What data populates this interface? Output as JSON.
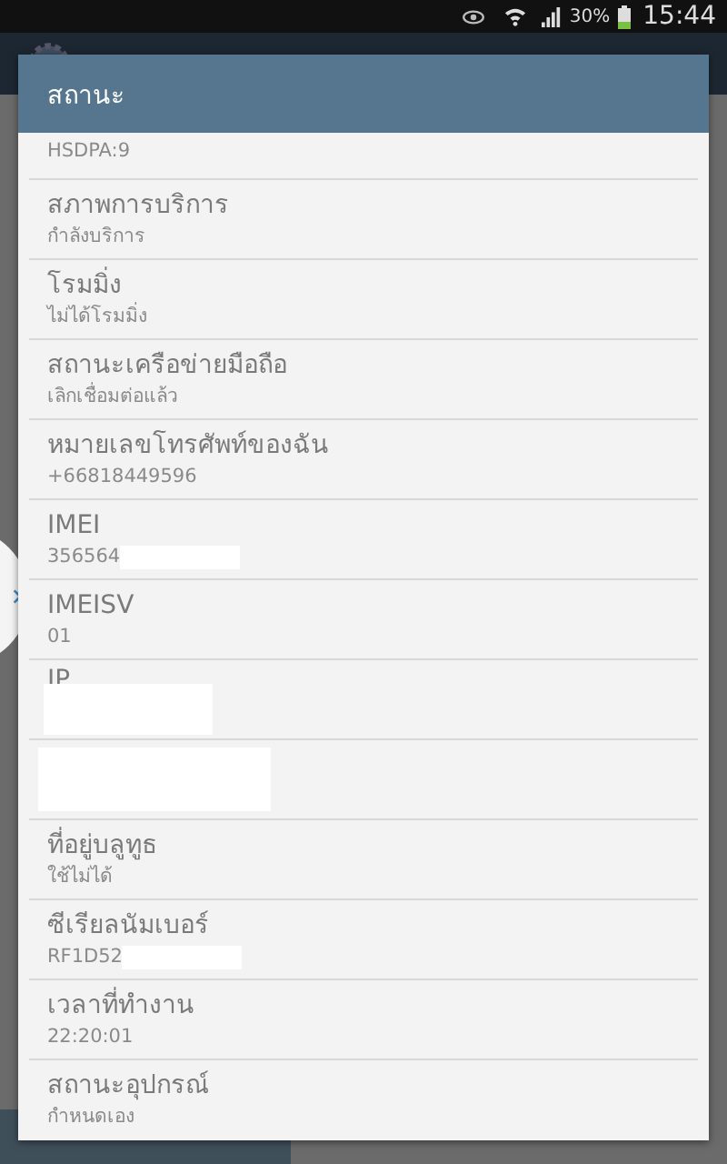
{
  "status_bar": {
    "battery": "30%",
    "time": "15:44"
  },
  "dialog": {
    "title": "สถานะ",
    "rows": [
      {
        "kind": "partial",
        "value": "HSDPA:9"
      },
      {
        "kind": "plain",
        "label": "สภาพการบริการ",
        "value": "กำลังบริการ"
      },
      {
        "kind": "plain",
        "label": "โรมมิ่ง",
        "value": "ไม่ได้โรมมิ่ง"
      },
      {
        "kind": "plain",
        "label": "สถานะเครือข่ายมือถือ",
        "value": "เลิกเชื่อมต่อแล้ว"
      },
      {
        "kind": "plain",
        "label": "หมายเลขโทรศัพท์ของฉัน",
        "value": "+66818449596"
      },
      {
        "kind": "redacted_value",
        "label": "IMEI",
        "value": "356564"
      },
      {
        "kind": "plain",
        "label": "IMEISV",
        "value": "01"
      },
      {
        "kind": "redacted_value",
        "label": "IP"
      },
      {
        "kind": "redacted_full"
      },
      {
        "kind": "plain",
        "label": "ที่อยู่บลูทูธ",
        "value": "ใช้ไม่ได้"
      },
      {
        "kind": "redacted_value",
        "label": "ซีเรียลนัมเบอร์",
        "value": "RF1D52"
      },
      {
        "kind": "plain",
        "label": "เวลาที่ทำงาน",
        "value": "22:20:01"
      },
      {
        "kind": "plain",
        "label": "สถานะอุปกรณ์",
        "value": "กำหนดเอง"
      }
    ]
  }
}
